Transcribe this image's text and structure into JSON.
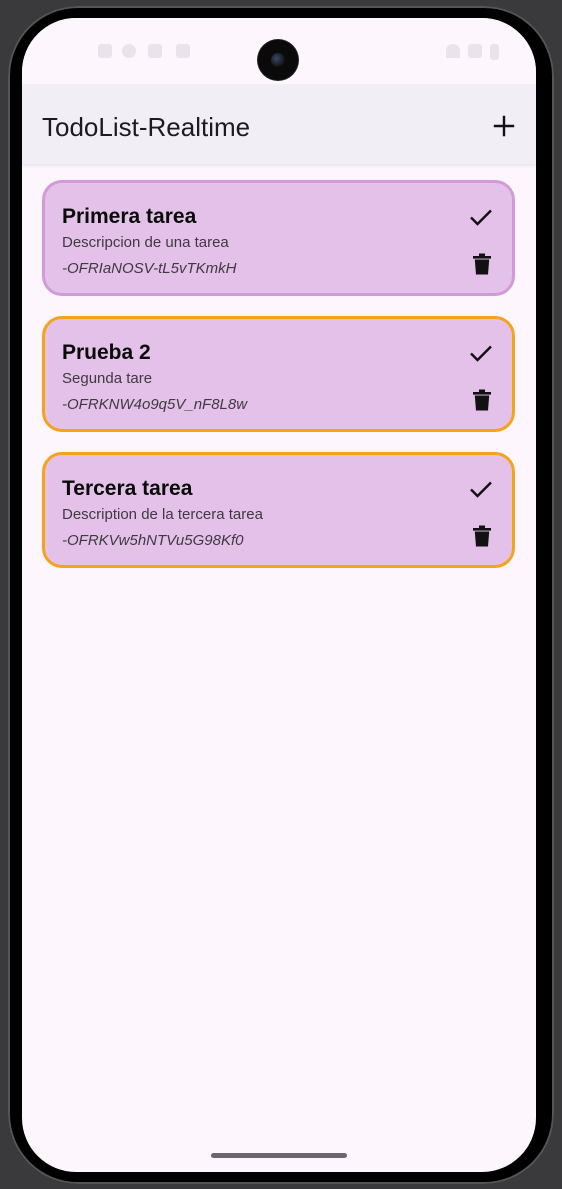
{
  "app_bar": {
    "title": "TodoList-Realtime",
    "add_icon": "plus-icon"
  },
  "colors": {
    "screen_background": "#fdf6fd",
    "app_bar_background": "#f2eef6",
    "card_background": "#e3c1e9",
    "card_border_default": "#d39ad8",
    "card_border_highlight": "#f6a21a"
  },
  "tasks": [
    {
      "title": "Primera tarea",
      "description": "Descripcion de una tarea",
      "id": "-OFRIaNOSV-tL5vTKmkH",
      "check_icon": "check-icon",
      "delete_icon": "trash-icon"
    },
    {
      "title": "Prueba 2",
      "description": "Segunda tare",
      "id": "-OFRKNW4o9q5V_nF8L8w",
      "check_icon": "check-icon",
      "delete_icon": "trash-icon"
    },
    {
      "title": "Tercera tarea",
      "description": "Description de la tercera tarea",
      "id": "-OFRKVw5hNTVu5G98Kf0",
      "check_icon": "check-icon",
      "delete_icon": "trash-icon"
    }
  ]
}
